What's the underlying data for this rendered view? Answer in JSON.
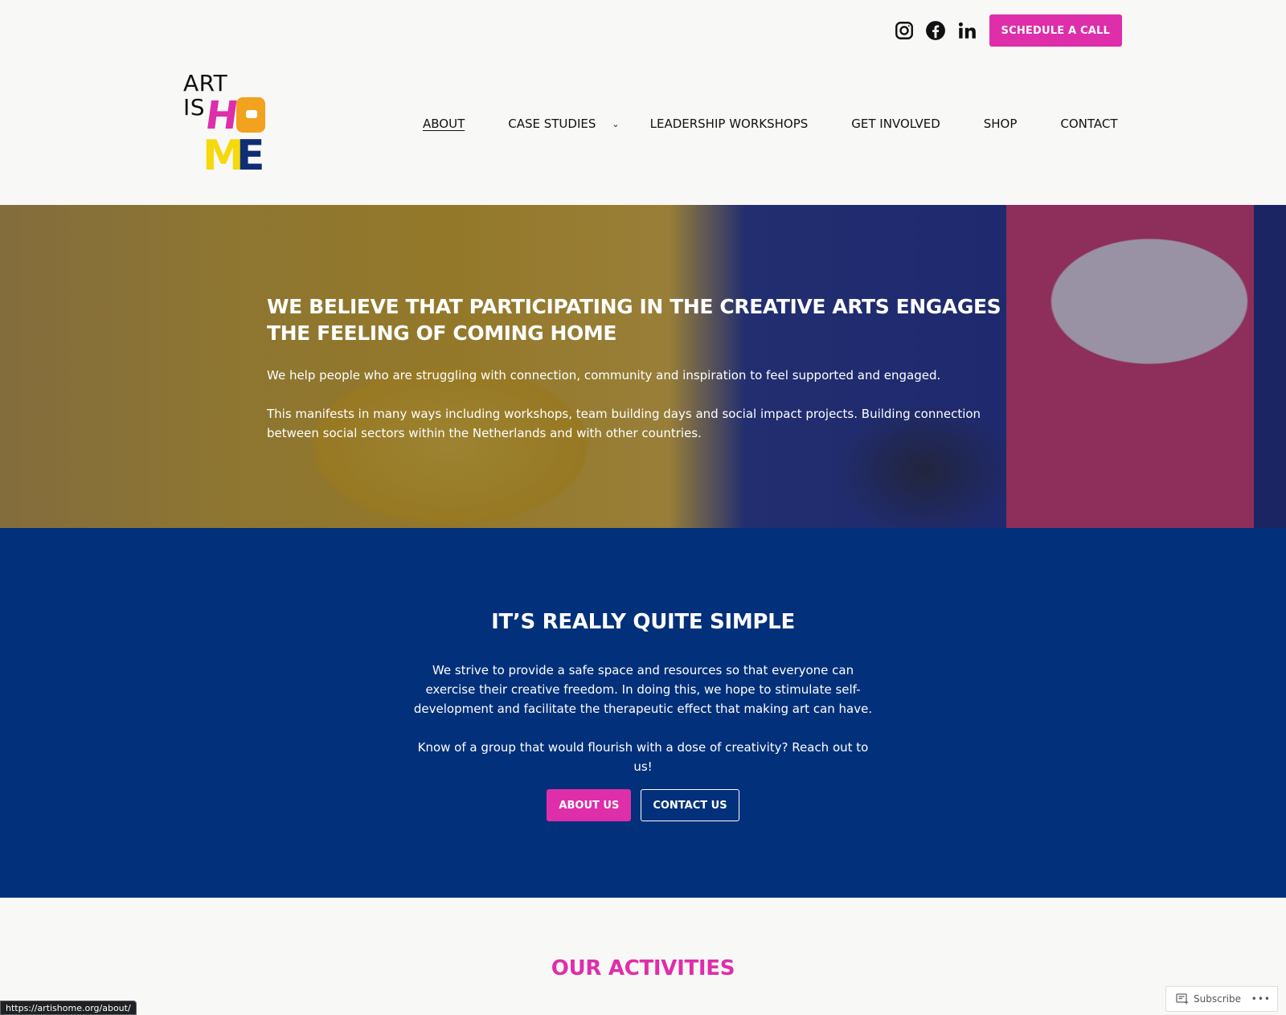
{
  "header": {
    "social": [
      {
        "icon": "instagram-icon"
      },
      {
        "icon": "facebook-icon"
      },
      {
        "icon": "linkedin-icon"
      }
    ],
    "schedule_button": "SCHEDULE A CALL",
    "logo": {
      "line1": "ART",
      "line2": "IS",
      "h": "H",
      "m": "M",
      "e": "E"
    },
    "nav": {
      "about": "ABOUT",
      "case_studies": "CASE STUDIES",
      "leadership": "LEADERSHIP WORKSHOPS",
      "get_involved": "GET INVOLVED",
      "shop": "SHOP",
      "contact": "CONTACT",
      "chevron": "⌄"
    }
  },
  "hero": {
    "title": "WE BELIEVE THAT PARTICIPATING IN THE CREATIVE ARTS ENGAGES THE FEELING OF COMING HOME",
    "p1": "We help people who are struggling with connection, community and inspiration to feel supported and engaged.",
    "p2": "This manifests in many ways including workshops, team building days and social impact projects. Building connection between social sectors within the Netherlands and with other countries."
  },
  "simple": {
    "title": "IT’S REALLY QUITE SIMPLE",
    "p1": "We strive to provide a safe space and resources so that everyone can exercise their creative freedom. In doing this, we hope to stimulate self-development and facilitate the therapeutic effect that making art can have.",
    "p2": "Know of a group that would flourish with a dose of creativity? Reach out to us!",
    "about_button": "ABOUT US",
    "contact_button": "CONTACT US"
  },
  "activities": {
    "title": "OUR ACTIVITIES"
  },
  "status_url": "https://artishome.org/about/",
  "subscribe": {
    "label": "Subscribe",
    "more": "•••"
  },
  "colors": {
    "accent": "#de2eaa",
    "navy": "#02307a",
    "orange": "#f2a21e",
    "yellow": "#f5d90c"
  }
}
